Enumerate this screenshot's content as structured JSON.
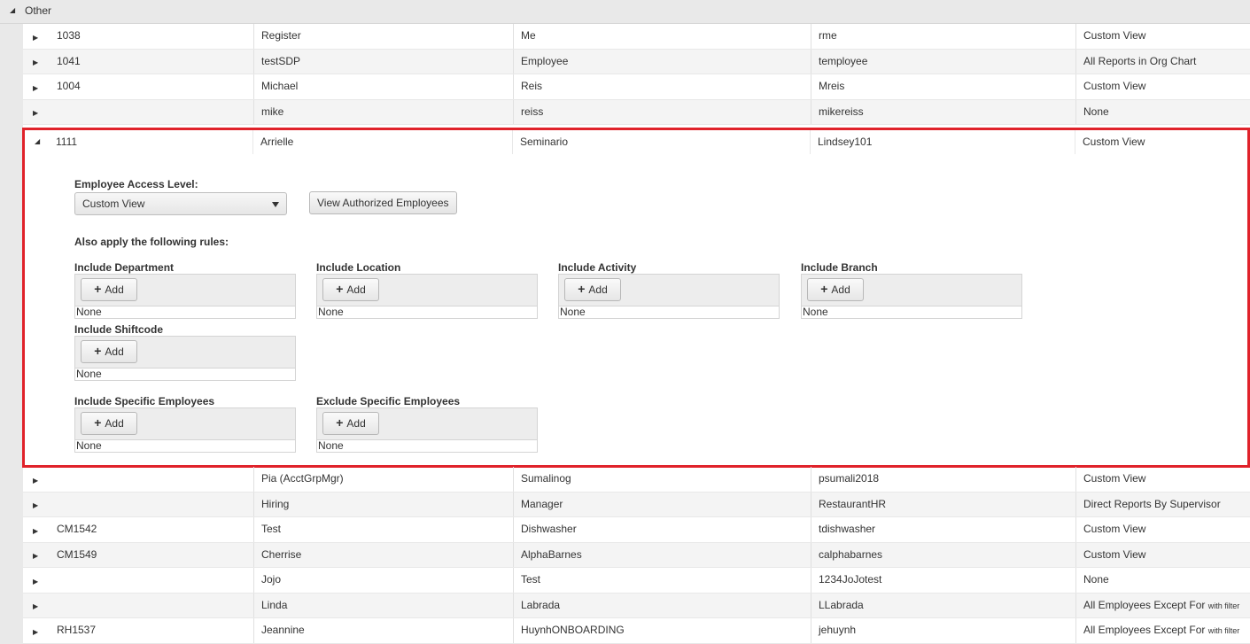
{
  "group": {
    "label": "Other"
  },
  "rows_top": [
    {
      "id": "1038",
      "first": "Register",
      "last": "Me",
      "user": "rme",
      "view": "Custom View",
      "note": ""
    },
    {
      "id": "1041",
      "first": "testSDP",
      "last": "Employee",
      "user": "temployee",
      "view": "All Reports in Org Chart",
      "note": ""
    },
    {
      "id": "1004",
      "first": "Michael",
      "last": "Reis",
      "user": "Mreis",
      "view": "Custom View",
      "note": ""
    },
    {
      "id": "",
      "first": "mike",
      "last": "reiss",
      "user": "mikereiss",
      "view": "None",
      "note": ""
    }
  ],
  "expanded": {
    "row": {
      "id": "1111",
      "first": "Arrielle",
      "last": "Seminario",
      "user": "Lindsey101",
      "view": "Custom View"
    },
    "access_level_label": "Employee Access Level:",
    "access_level_value": "Custom View",
    "view_authorized_button": "View Authorized Employees",
    "also_apply_label": "Also apply the following rules:",
    "add_label": "Add",
    "rules": [
      {
        "title": "Include Department",
        "value": "None"
      },
      {
        "title": "Include Location",
        "value": "None"
      },
      {
        "title": "Include Activity",
        "value": "None"
      },
      {
        "title": "Include Branch",
        "value": "None"
      },
      {
        "title": "Include Shiftcode",
        "value": "None"
      },
      {
        "title": "Include Specific Employees",
        "value": "None"
      },
      {
        "title": "Exclude Specific Employees",
        "value": "None"
      }
    ]
  },
  "rows_bottom": [
    {
      "id": "",
      "first": "Pia (AcctGrpMgr)",
      "last": "Sumalinog",
      "user": "psumali2018",
      "view": "Custom View",
      "note": ""
    },
    {
      "id": "",
      "first": "Hiring",
      "last": "Manager",
      "user": "RestaurantHR",
      "view": "Direct Reports By Supervisor",
      "note": ""
    },
    {
      "id": "CM1542",
      "first": "Test",
      "last": "Dishwasher",
      "user": "tdishwasher",
      "view": "Custom View",
      "note": ""
    },
    {
      "id": "CM1549",
      "first": "Cherrise",
      "last": "AlphaBarnes",
      "user": "calphabarnes",
      "view": "Custom View",
      "note": ""
    },
    {
      "id": "",
      "first": "Jojo",
      "last": "Test",
      "user": "1234JoJotest",
      "view": "None",
      "note": ""
    },
    {
      "id": "",
      "first": "Linda",
      "last": "Labrada",
      "user": "LLabrada",
      "view": "All Employees Except For",
      "note": "with filter"
    },
    {
      "id": "RH1537",
      "first": "Jeannine",
      "last": "HuynhONBOARDING",
      "user": "jehuynh",
      "view": "All Employees Except For",
      "note": "with filter"
    }
  ],
  "colors": {
    "highlight_border": "#e0222a",
    "header_bg": "#e9e9e9",
    "alt_row_bg": "#f4f4f4"
  },
  "icons": {
    "collapsed": "triangle-right-icon",
    "expanded": "triangle-down-icon"
  }
}
